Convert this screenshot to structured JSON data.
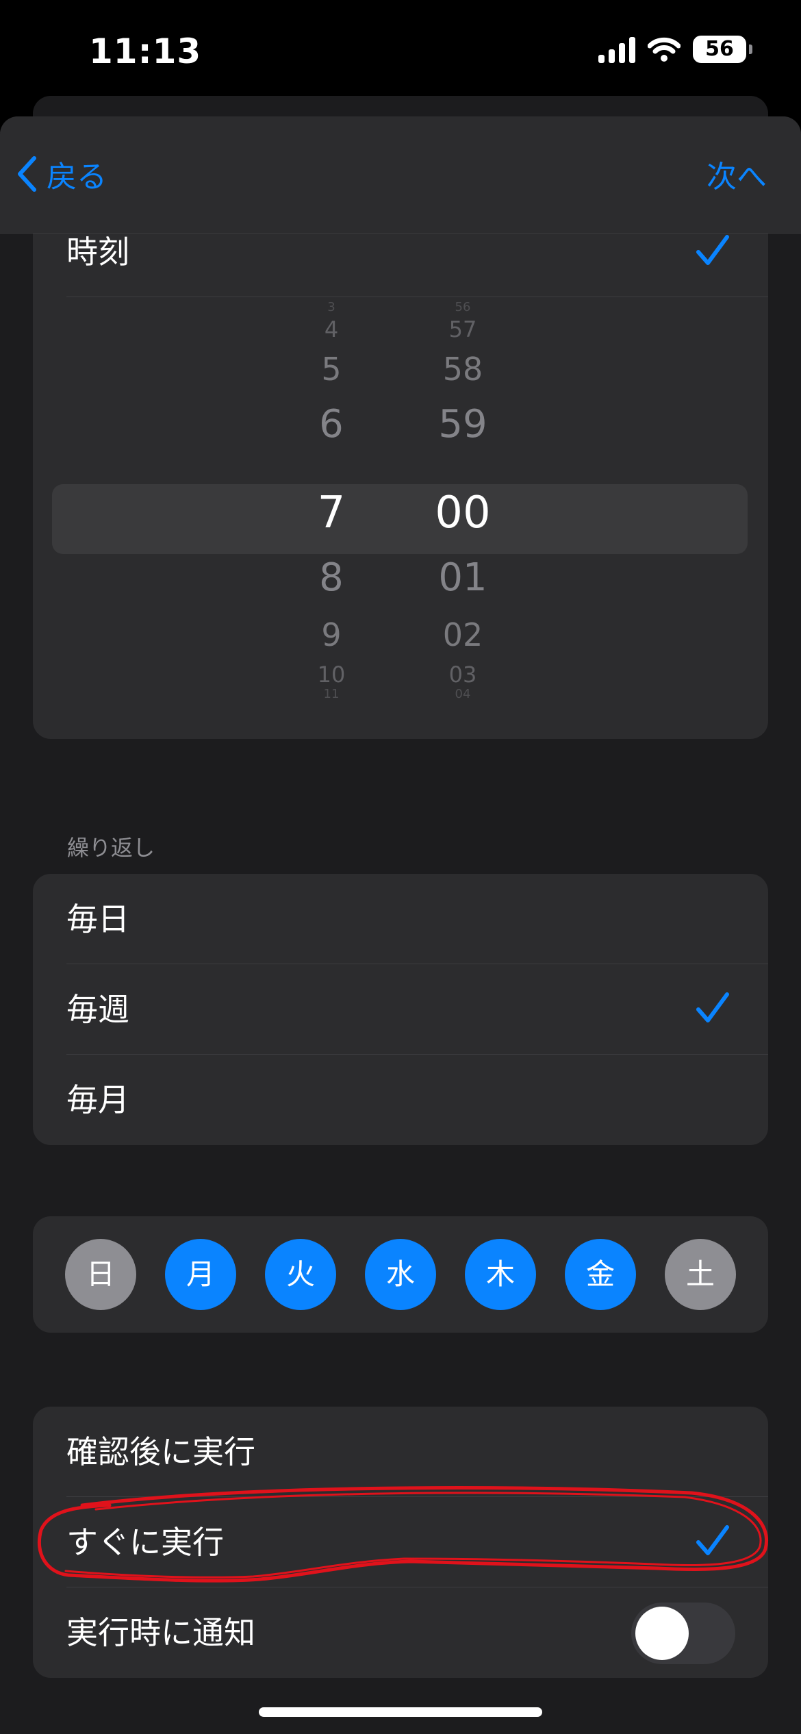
{
  "status_bar": {
    "time": "11:13",
    "battery": "56"
  },
  "nav": {
    "back_label": "戻る",
    "next_label": "次へ"
  },
  "time_section": {
    "row_label": "時刻",
    "picker": {
      "hours": [
        "3",
        "4",
        "5",
        "6",
        "7",
        "8",
        "9",
        "10",
        "11"
      ],
      "minutes": [
        "56",
        "57",
        "58",
        "59",
        "00",
        "01",
        "02",
        "03",
        "04"
      ],
      "selected_hour": "7",
      "selected_minute": "00"
    }
  },
  "repeat_section": {
    "header": "繰り返し",
    "options": [
      {
        "label": "毎日",
        "checked": false
      },
      {
        "label": "毎週",
        "checked": true
      },
      {
        "label": "毎月",
        "checked": false
      }
    ]
  },
  "weekdays": [
    {
      "label": "日",
      "selected": false
    },
    {
      "label": "月",
      "selected": true
    },
    {
      "label": "火",
      "selected": true
    },
    {
      "label": "水",
      "selected": true
    },
    {
      "label": "木",
      "selected": true
    },
    {
      "label": "金",
      "selected": true
    },
    {
      "label": "土",
      "selected": false
    }
  ],
  "run_section": {
    "options": [
      {
        "label": "確認後に実行",
        "checked": false
      },
      {
        "label": "すぐに実行",
        "checked": true
      }
    ],
    "notify_label": "実行時に通知",
    "notify_on": false
  },
  "colors": {
    "accent": "#0a84ff",
    "day_unselected": "#8e8e93",
    "annotation": "#e0121b"
  }
}
